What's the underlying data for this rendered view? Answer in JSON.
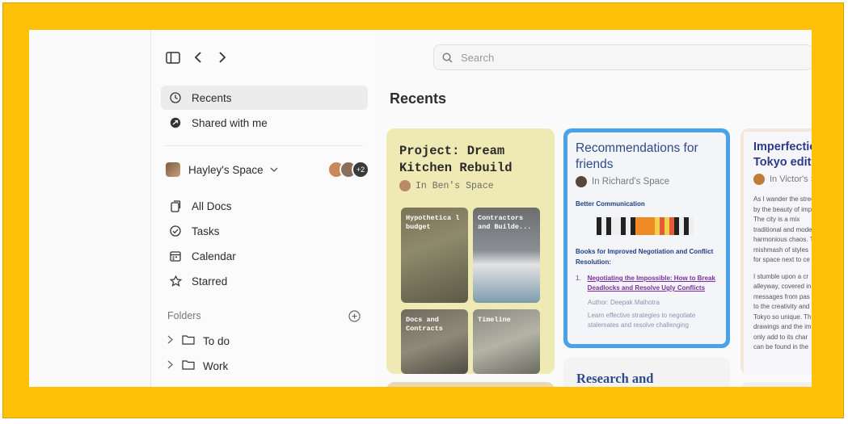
{
  "colors": {
    "frame": "#ffc107",
    "card1_bg": "#efe9b4",
    "card2_border": "#4aa3ea",
    "link": "#7a2fa0",
    "accent_title": "#2d4a8a"
  },
  "toolbar": {
    "sidebar_toggle_icon": "sidebar-icon",
    "back_icon": "chevron-left-icon",
    "forward_icon": "chevron-right-icon"
  },
  "search": {
    "placeholder": "Search"
  },
  "sidebar": {
    "top_items": [
      {
        "label": "Recents",
        "icon": "clock-icon",
        "active": true
      },
      {
        "label": "Shared with me",
        "icon": "share-icon",
        "active": false
      }
    ],
    "space": {
      "name": "Hayley's Space",
      "members_more": "+2"
    },
    "items": [
      {
        "label": "All Docs",
        "icon": "docs-icon"
      },
      {
        "label": "Tasks",
        "icon": "check-circle-icon"
      },
      {
        "label": "Calendar",
        "icon": "calendar-icon"
      },
      {
        "label": "Starred",
        "icon": "star-icon"
      }
    ],
    "folders_label": "Folders",
    "folders": [
      {
        "label": "To do"
      },
      {
        "label": "Work"
      }
    ]
  },
  "main": {
    "title": "Recents",
    "cards": {
      "kitchen": {
        "title": "Project: Dream Kitchen Rebuild",
        "space": "In Ben's Space",
        "tiles": [
          "Hypothetica l budget",
          "Contractors and Builde...",
          "Docs and Contracts",
          "Timeline"
        ]
      },
      "recommendations": {
        "title": "Recommendations for friends",
        "space": "In Richard's Space",
        "heading": "Better Communication",
        "subheading": "Books for Improved Negotiation and Conflict Resolution:",
        "item_number": "1.",
        "item_link": "Negotiating the Impossible: How to Break Deadlocks and Resolve Ugly Conflicts",
        "author": "Author: Deepak Malhotra",
        "desc": "Learn effective strategies to negotiate stalemates and resolve challenging"
      },
      "tokyo": {
        "title_line1": "Imperfectio",
        "title_line2": "Tokyo editio",
        "space": "In Victor's S",
        "p1": [
          "As I wander the stree",
          "by the beauty of imp",
          "The city is a mix",
          "traditional and mode",
          "harmonious chaos. T",
          "mishmash of styles",
          "for space next to ce"
        ],
        "p2": [
          "I stumble upon a cr",
          "alleyway, covered in",
          "messages from pas",
          "to the creativity and",
          "Tokyo so unique. Th",
          "drawings and the im",
          "only add to its char",
          "can be found in the"
        ]
      },
      "research": {
        "title": "Research and"
      }
    }
  }
}
